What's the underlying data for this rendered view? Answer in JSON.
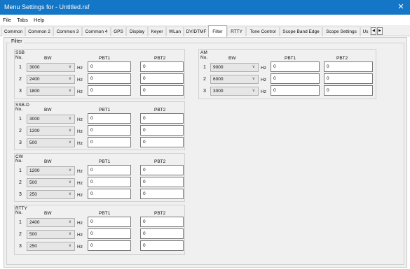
{
  "window": {
    "title": "Menu Settings for  - Untitled.rsf",
    "close_glyph": "✕"
  },
  "menu": [
    "File",
    "Tabs",
    "Help"
  ],
  "tabs": [
    {
      "label": "Common"
    },
    {
      "label": "Common 2"
    },
    {
      "label": "Common 3"
    },
    {
      "label": "Common 4"
    },
    {
      "label": "GPS"
    },
    {
      "label": "Display"
    },
    {
      "label": "Keyer"
    },
    {
      "label": "WLan"
    },
    {
      "label": "DV/DTMF"
    },
    {
      "label": "Filter",
      "active": true
    },
    {
      "label": "RTTY"
    },
    {
      "label": "Tone Control"
    },
    {
      "label": "Scope Band Edge"
    },
    {
      "label": "Scope Settings"
    },
    {
      "label": "Us"
    }
  ],
  "tab_scroll": {
    "left": "◀",
    "right": "▶"
  },
  "filter": {
    "label": "Filter",
    "col_no": "No.",
    "col_bw": "BW",
    "col_pbt1": "PBT1",
    "col_pbt2": "PBT2",
    "hz": "Hz",
    "chevron": "∨",
    "groups": [
      {
        "title": "SSB",
        "rows": [
          {
            "no": "1",
            "bw": "3000",
            "pbt1": "0",
            "pbt2": "0"
          },
          {
            "no": "2",
            "bw": "2400",
            "pbt1": "0",
            "pbt2": "0"
          },
          {
            "no": "3",
            "bw": "1800",
            "pbt1": "0",
            "pbt2": "0"
          }
        ]
      },
      {
        "title": "SSB-D",
        "rows": [
          {
            "no": "1",
            "bw": "3000",
            "pbt1": "0",
            "pbt2": "0"
          },
          {
            "no": "2",
            "bw": "1200",
            "pbt1": "0",
            "pbt2": "0"
          },
          {
            "no": "3",
            "bw": "500",
            "pbt1": "0",
            "pbt2": "0"
          }
        ]
      },
      {
        "title": "CW",
        "rows": [
          {
            "no": "1",
            "bw": "1200",
            "pbt1": "0",
            "pbt2": "0"
          },
          {
            "no": "2",
            "bw": "500",
            "pbt1": "0",
            "pbt2": "0"
          },
          {
            "no": "3",
            "bw": "250",
            "pbt1": "0",
            "pbt2": "0"
          }
        ]
      },
      {
        "title": "RTTY",
        "rows": [
          {
            "no": "1",
            "bw": "2400",
            "pbt1": "0",
            "pbt2": "0"
          },
          {
            "no": "2",
            "bw": "500",
            "pbt1": "0",
            "pbt2": "0"
          },
          {
            "no": "3",
            "bw": "250",
            "pbt1": "0",
            "pbt2": "0"
          }
        ]
      },
      {
        "title": "AM",
        "rows": [
          {
            "no": "1",
            "bw": "9000",
            "pbt1": "0",
            "pbt2": "0"
          },
          {
            "no": "2",
            "bw": "6000",
            "pbt1": "0",
            "pbt2": "0"
          },
          {
            "no": "3",
            "bw": "3000",
            "pbt1": "0",
            "pbt2": "0"
          }
        ]
      }
    ]
  }
}
